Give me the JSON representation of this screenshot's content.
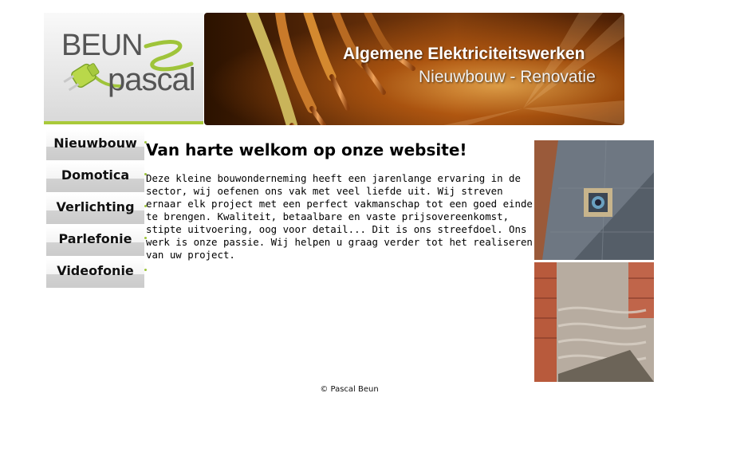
{
  "brand": {
    "logo_line1": "BEUN",
    "logo_line2": "pascal",
    "accent_color": "#a9c93a"
  },
  "banner": {
    "title": "Algemene Elektriciteitswerken",
    "subtitle": "Nieuwbouw - Renovatie"
  },
  "nav": {
    "items": [
      {
        "label": "Nieuwbouw"
      },
      {
        "label": "Domotica"
      },
      {
        "label": "Verlichting"
      },
      {
        "label": "Parlefonie"
      },
      {
        "label": "Videofonie"
      }
    ]
  },
  "main": {
    "heading": "Van harte welkom op onze website!",
    "body": "Deze kleine bouwonderneming heeft een jarenlange ervaring in de sector, wij oefenen ons vak met veel liefde uit. Wij streven ernaar elk project met een perfect vakmanschap tot een goed einde te brengen. Kwaliteit, betaalbare en vaste prijsovereenkomst, stipte uitvoering, oog voor detail... Dit is ons streefdoel. Ons werk is onze passie. Wij helpen u graag verder tot het realiseren van uw project."
  },
  "footer": {
    "text": "© Pascal Beun"
  }
}
